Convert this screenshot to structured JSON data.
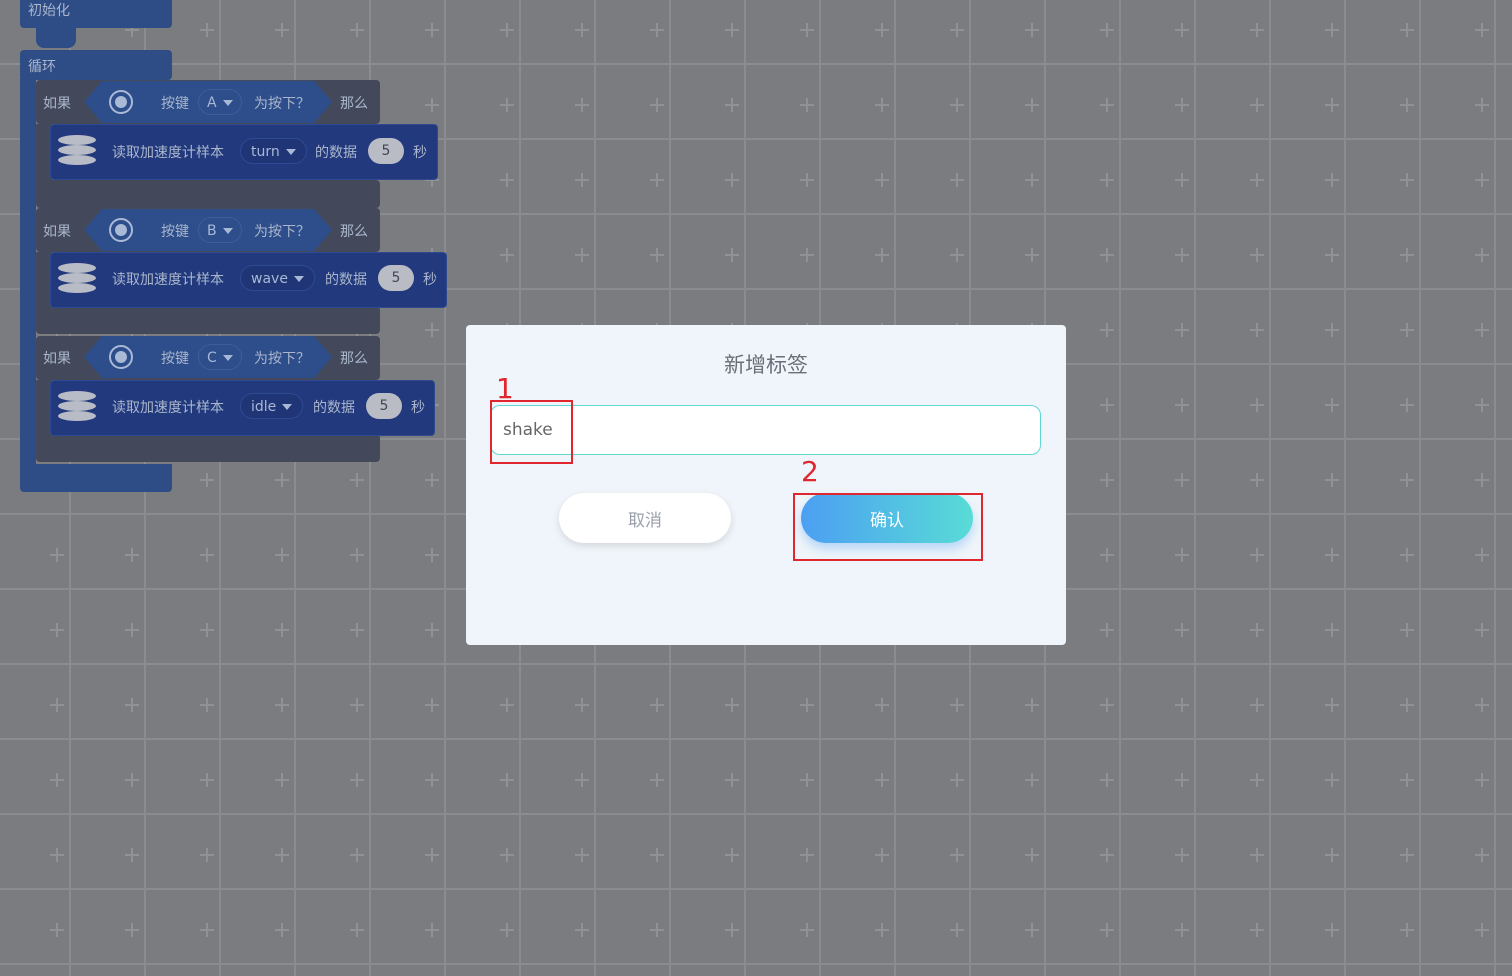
{
  "workspace": {
    "init_block": {
      "label": "初始化"
    },
    "loop_block": {
      "label": "循环"
    },
    "if_blocks": [
      {
        "if_label": "如果",
        "key_label": "按键",
        "key": "A",
        "pressed_label": "为按下？",
        "then_label": "那么",
        "read": {
          "label": "读取加速度计样本",
          "sample": "turn",
          "data_label": "的数据",
          "seconds": "5",
          "unit": "秒"
        }
      },
      {
        "if_label": "如果",
        "key_label": "按键",
        "key": "B",
        "pressed_label": "为按下？",
        "then_label": "那么",
        "read": {
          "label": "读取加速度计样本",
          "sample": "wave",
          "data_label": "的数据",
          "seconds": "5",
          "unit": "秒"
        }
      },
      {
        "if_label": "如果",
        "key_label": "按键",
        "key": "C",
        "pressed_label": "为按下？",
        "then_label": "那么",
        "read": {
          "label": "读取加速度计样本",
          "sample": "idle",
          "data_label": "的数据",
          "seconds": "5",
          "unit": "秒"
        }
      }
    ]
  },
  "dialog": {
    "title": "新增标签",
    "input_value": "shake",
    "cancel_label": "取消",
    "confirm_label": "确认"
  },
  "annotations": {
    "step1": "1",
    "step2": "2"
  },
  "icons": {
    "button": "button-circle-icon",
    "database": "database-icon"
  },
  "colors": {
    "hat_block": "#2e4d86",
    "condition_block": "#43495a",
    "read_block": "#223a7d",
    "confirm_gradient_start": "#4c9ff2",
    "confirm_gradient_end": "#58dcd6",
    "annotation_red": "#e0262e"
  }
}
